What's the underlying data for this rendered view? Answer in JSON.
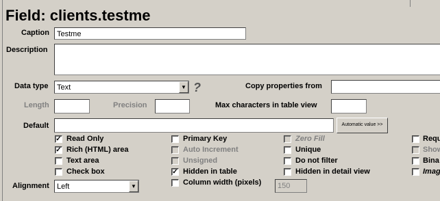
{
  "title": "Field: clients.testme",
  "caption": {
    "label": "Caption",
    "value": "Testme"
  },
  "description": {
    "label": "Description",
    "value": ""
  },
  "data_type": {
    "label": "Data type",
    "value": "Text",
    "help": "?"
  },
  "copy_props": {
    "label": "Copy properties from",
    "value": ""
  },
  "length": {
    "label": "Length",
    "value": ""
  },
  "precision": {
    "label": "Precision",
    "value": ""
  },
  "max_chars": {
    "label": "Max characters in table view",
    "value": ""
  },
  "default": {
    "label": "Default",
    "value": "",
    "button": "Automatic value >>"
  },
  "checks": {
    "read_only": {
      "label": "Read Only",
      "checked": true
    },
    "rich_html": {
      "label": "Rich (HTML) area",
      "checked": true
    },
    "text_area": {
      "label": "Text area",
      "checked": false
    },
    "check_box": {
      "label": "Check box",
      "checked": false
    },
    "primary_key": {
      "label": "Primary Key",
      "checked": false
    },
    "auto_increment": {
      "label": "Auto Increment",
      "checked": false
    },
    "unsigned": {
      "label": "Unsigned",
      "checked": false
    },
    "hidden_table": {
      "label": "Hidden in table",
      "checked": true
    },
    "column_width": {
      "label": "Column width (pixels)",
      "checked": false,
      "value": "150"
    },
    "zero_fill": {
      "label": "Zero Fill",
      "checked": false
    },
    "unique": {
      "label": "Unique",
      "checked": false
    },
    "no_filter": {
      "label": "Do not filter",
      "checked": false
    },
    "hidden_detail": {
      "label": "Hidden in detail view",
      "checked": false
    },
    "required": {
      "label": "Requ",
      "checked": false
    },
    "show": {
      "label": "Show",
      "checked": false
    },
    "binary": {
      "label": "Bina",
      "checked": false
    },
    "image": {
      "label": "Imag",
      "checked": false
    }
  },
  "alignment": {
    "label": "Alignment",
    "value": "Left"
  },
  "checkmark": "✓"
}
